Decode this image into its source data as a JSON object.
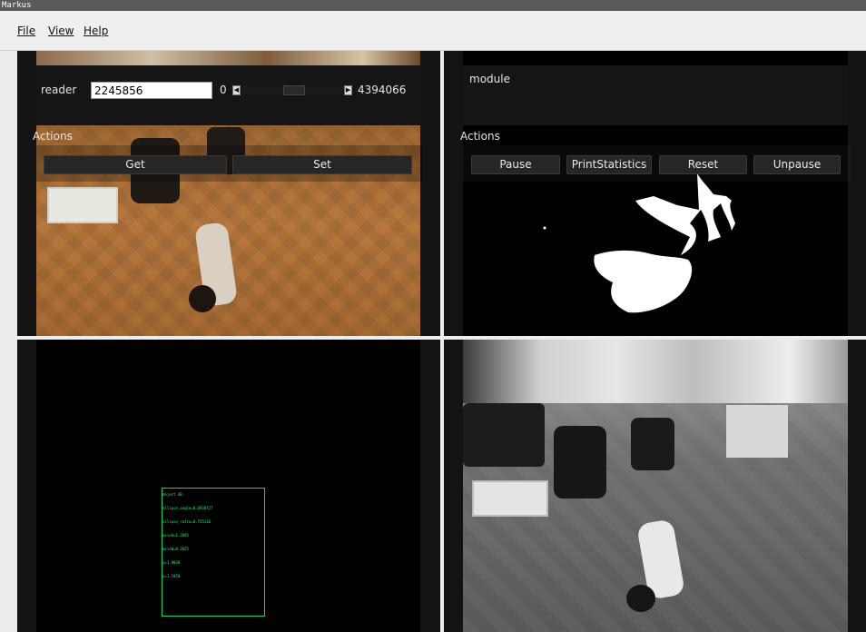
{
  "window": {
    "title": "Markus"
  },
  "menu": {
    "file": "File",
    "view": "View",
    "help": "Help"
  },
  "reader": {
    "label": "reader",
    "frame_value": "2245856",
    "range_min": "0",
    "range_max": "4394066",
    "actions_label": "Actions",
    "buttons": {
      "get": "Get",
      "set": "Set"
    }
  },
  "module": {
    "label": "module",
    "actions_label": "Actions",
    "buttons": {
      "pause": "Pause",
      "print_statistics": "PrintStatistics",
      "reset": "Reset",
      "unpause": "Unpause"
    }
  },
  "detection": {
    "text_lines": [
      "object 48",
      "ellipse_angle=0.6930727",
      "ellipse_ratio=0.755136",
      "axisH=1.2095",
      "axisW=0.2025",
      "x=1.9030",
      "y=1.1970"
    ],
    "color": "#19d36b"
  },
  "icons": {
    "left_arrow": "triangle-left-icon",
    "right_arrow": "triangle-right-icon"
  }
}
